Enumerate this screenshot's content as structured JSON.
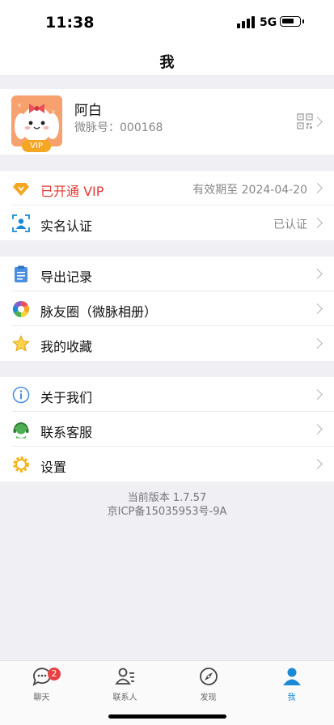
{
  "status": {
    "time": "11:38",
    "network": "5G"
  },
  "nav": {
    "title": "我"
  },
  "profile": {
    "name": "阿白",
    "id_label": "微脉号：000168",
    "vip_badge": "VIP"
  },
  "group1": [
    {
      "label": "已开通 VIP",
      "value": "有效期至 2024-04-20",
      "icon": "diamond-icon"
    },
    {
      "label": "实名认证",
      "value": "已认证",
      "icon": "id-card-icon"
    }
  ],
  "group2": [
    {
      "label": "导出记录",
      "icon": "clipboard-icon"
    },
    {
      "label": "脉友圈（微脉相册）",
      "icon": "aperture-icon"
    },
    {
      "label": "我的收藏",
      "icon": "star-icon"
    }
  ],
  "group3": [
    {
      "label": "关于我们",
      "icon": "info-icon"
    },
    {
      "label": "联系客服",
      "icon": "headset-icon"
    },
    {
      "label": "设置",
      "icon": "gear-icon"
    }
  ],
  "version": {
    "line1": "当前版本 1.7.57",
    "line2": "京ICP备15035953号-9A"
  },
  "tabs": [
    {
      "label": "聊天",
      "badge": "2",
      "icon": "chat-icon"
    },
    {
      "label": "联系人",
      "icon": "contacts-icon"
    },
    {
      "label": "发现",
      "icon": "compass-icon"
    },
    {
      "label": "我",
      "icon": "person-icon",
      "active": true
    }
  ],
  "colors": {
    "accent": "#1a8ad6",
    "vip_red": "#e53935",
    "badge_red": "#e84040",
    "vip_gold": "#f5a623"
  }
}
